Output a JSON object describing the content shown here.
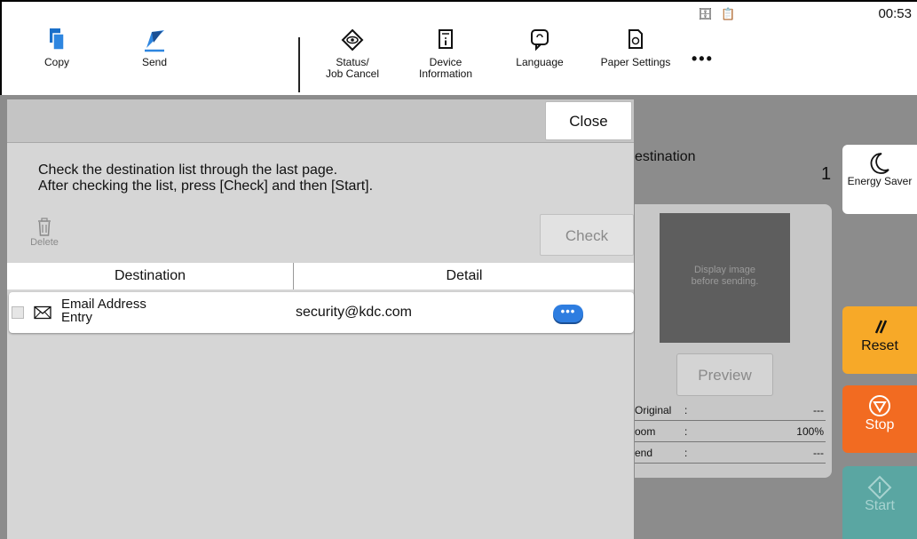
{
  "status_bar": {
    "icons": "🗄 📋",
    "time": "00:53"
  },
  "toolbar": {
    "copy_label": "Copy",
    "send_label": "Send",
    "status_label_1": "Status/",
    "status_label_2": "Job Cancel",
    "device_label_1": "Device",
    "device_label_2": "Information",
    "language_label": "Language",
    "paper_label": "Paper Settings",
    "more_label": "•••"
  },
  "background": {
    "destination_title": "estination",
    "destination_count": "1",
    "preview_text_1": "Display image",
    "preview_text_2": "before sending.",
    "preview_button": "Preview",
    "info": [
      {
        "key": "Original",
        "colon": ":",
        "value": "---"
      },
      {
        "key": "oom",
        "colon": ":",
        "value": "100%"
      },
      {
        "key": "end",
        "colon": ":",
        "value": "---"
      }
    ]
  },
  "side_buttons": {
    "energy_saver": "Energy Saver",
    "reset": "Reset",
    "stop": "Stop",
    "start": "Start"
  },
  "dialog": {
    "close_label": "Close",
    "message_line1": "Check the destination list through the last page.",
    "message_line2": "After checking the list, press [Check] and then [Start].",
    "delete_label": "Delete",
    "check_label": "Check",
    "columns": {
      "destination": "Destination",
      "detail": "Detail"
    },
    "rows": [
      {
        "destination_1": "Email Address",
        "destination_2": "Entry",
        "detail": "security@kdc.com",
        "more": "•••"
      }
    ]
  },
  "colors": {
    "accent_blue": "#2e7de0",
    "reset_orange": "#f7a928",
    "stop_orange": "#f26b21",
    "start_teal": "#5aa6a2"
  }
}
